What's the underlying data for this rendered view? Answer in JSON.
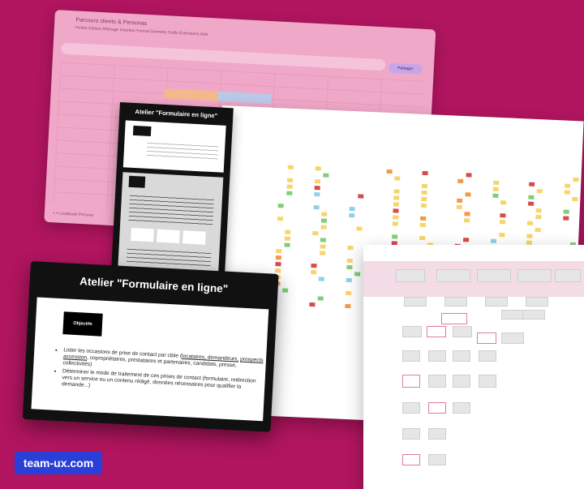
{
  "spreadsheet": {
    "title": "Parcours clients & Personas",
    "menu": "Fichier  Édition  Affichage  Insertion  Format  Données  Outils  Extensions  Aide",
    "share_label": "Partager",
    "tabs": "+  ≡  Lookbook  Persona"
  },
  "card_back": {
    "title": "Atelier \"Formulaire en ligne\""
  },
  "card_front": {
    "title": "Atelier \"Formulaire en ligne\"",
    "objective_label": "Objectifs",
    "bullet1_prefix": "Lister les occasions de prise de contact par cible (",
    "bullet1_link1": "locataires, demandeurs,",
    "bullet1_link2": "prospects accession",
    "bullet1_suffix": ", copropriétaires, prestataires et partenaires, candidats, presse, collectivités)",
    "bullet2": "Déterminer le mode de traitement de ces prises de contact (formulaire, redirection vers un service ou un contenu rédigé, données nécessaires pour qualifier la demande...)"
  },
  "badge": {
    "label": "team-ux.com"
  },
  "colors": {
    "background": "#b1155f",
    "badge": "#2a3ed8",
    "postit_yellow": "#f7d56a",
    "postit_blue": "#8fd0ec",
    "postit_orange": "#f29a4a",
    "postit_green": "#7fcf7a",
    "postit_red": "#d84b4b"
  }
}
